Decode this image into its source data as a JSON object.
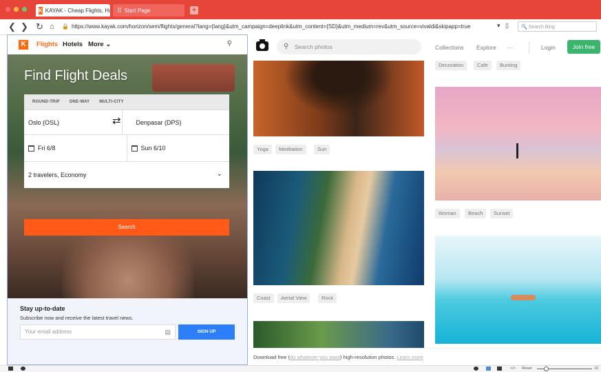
{
  "browser": {
    "tabs": [
      {
        "label": "KAYAK - Cheap Flights, Hotels"
      },
      {
        "label": "Start Page"
      }
    ],
    "url": "https://www.kayak.com/horizon/sem/flights/general?lang={lang}&utm_campaign=deeplink&utm_content={SD}&utm_medium=rev&utm_source=vivaldi&skipapp=true",
    "search_placeholder": "Search Bing",
    "colors": {
      "tabbar": "#e8453a"
    }
  },
  "kayak": {
    "logo": "K",
    "nav": [
      "Flights",
      "Hotels",
      "More"
    ],
    "title": "Find Flight Deals",
    "trip_types": [
      "ROUND-TRIP",
      "ONE-WAY",
      "MULTI-CITY"
    ],
    "origin": "Oslo (OSL)",
    "destination": "Denpasar (DPS)",
    "depart": "Fri 6/8",
    "return": "Sun 6/10",
    "travelers": "2 travelers, Economy",
    "search_label": "Search",
    "newsletter": {
      "title": "Stay up-to-date",
      "subtitle": "Subscribe now and receive the latest travel news.",
      "email_placeholder": "Your email address",
      "signup_label": "SIGN UP"
    },
    "colors": {
      "brand": "#ff690f",
      "search": "#ff5a17",
      "signup": "#2d7ff9"
    }
  },
  "unsplash": {
    "search_placeholder": "Search photos",
    "nav": [
      "Collections",
      "Explore",
      "···",
      "Login"
    ],
    "join_label": "Join free",
    "tags": {
      "top_right": [
        "Decoration",
        "Cafe",
        "Bunting"
      ],
      "photo1": [
        "Yoga",
        "Meditation",
        "Sun"
      ],
      "photo2": [
        "Coast",
        "Aerial View",
        "Rock"
      ],
      "photo4": [
        "Woman",
        "Beach",
        "Sunset"
      ]
    },
    "footer": {
      "prefix": "Download free (",
      "link": "do whatever you want",
      "suffix": ") high-resolution photos.",
      "learn_more": "Learn more"
    },
    "colors": {
      "join": "#3cb46e"
    }
  },
  "statusbar": {
    "reset_label": "Reset",
    "zoom": "10"
  }
}
